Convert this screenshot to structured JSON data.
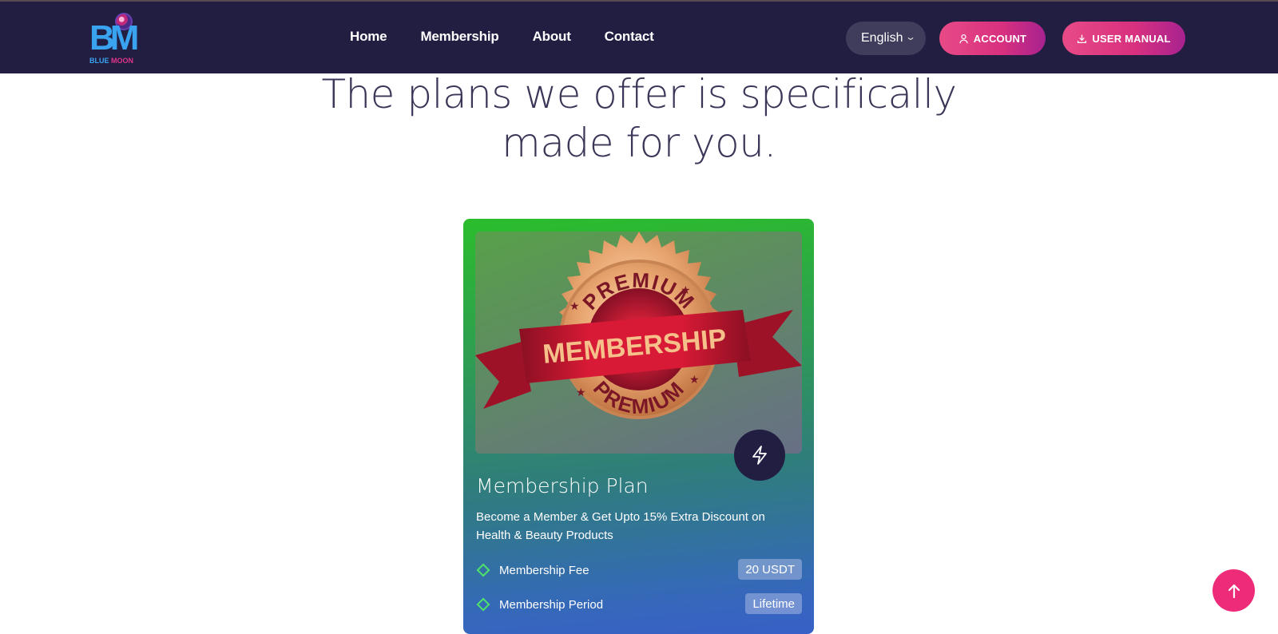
{
  "brand": {
    "letters": "BM",
    "name_part1": "BLUE",
    "name_part2": "MOON"
  },
  "nav": {
    "items": [
      "Home",
      "Membership",
      "About",
      "Contact"
    ]
  },
  "language": {
    "selected": "English"
  },
  "buttons": {
    "account": "ACCOUNT",
    "user_manual": "USER MANUAL"
  },
  "hero": {
    "line1": "The plans we offer is specifically",
    "line2": "made for you."
  },
  "plan_card": {
    "image": {
      "top_text": "PREMIUM",
      "ribbon_text": "MEMBERSHIP",
      "bottom_text": "PREMIUM"
    },
    "title": "Membership Plan",
    "description": "Become a Member & Get Upto 15% Extra Discount on Health & Beauty Products",
    "features": [
      {
        "label": "Membership Fee",
        "value": "20 USDT"
      },
      {
        "label": "Membership Period",
        "value": "Lifetime"
      }
    ]
  },
  "icons": [
    "user-icon",
    "download-icon",
    "chevron-down-icon",
    "bolt-icon",
    "arrow-up-icon",
    "diamond-bullet-icon"
  ],
  "colors": {
    "header_bg": "#211e42",
    "accent_pink": "#e84a86",
    "accent_purple": "#a7228f",
    "card_green": "#2bbd2c",
    "card_blue": "#3860c8"
  }
}
